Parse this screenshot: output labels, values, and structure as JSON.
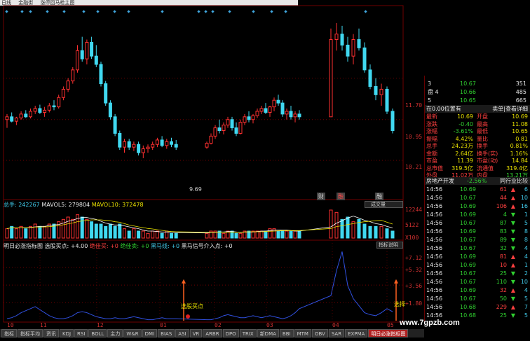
{
  "titlebar": {
    "items": [
      "日线",
      "金融街",
      "涨停回马枪主图"
    ]
  },
  "main_axis": {
    "labels": [
      "11.70",
      "10.95",
      "10.21"
    ]
  },
  "low_marker": "9.69",
  "markers": {
    "m1": "财",
    "m2": "融",
    "m3": "融"
  },
  "vol_legend": {
    "total": "总手: 242267",
    "ma5": "MAVOL5: 279804",
    "ma10": "MAVOL10: 372478"
  },
  "vol_axis": [
    "12244",
    "5122",
    "X100"
  ],
  "vol_badge": "成交量",
  "ind_legend": {
    "title": "明日必涨指标图",
    "a": "选股买点: +4.00",
    "b": "绝佳买: +0",
    "c": "绝佳卖: +0",
    "d": "黑马线: +0",
    "e": "黑马信号介入点: +0"
  },
  "ind_badge": "指标说明",
  "ind_axis": [
    "+7.12",
    "+5.32",
    "+3.56",
    "+1.80"
  ],
  "ind_annotations": {
    "buy": "选股买点",
    "pick": "选择"
  },
  "xaxis": [
    "10",
    "11",
    "12",
    "01",
    "02",
    "03",
    "04",
    "05"
  ],
  "tabs": [
    "指标",
    "指标平均",
    "资讯",
    "KDJ",
    "RSI",
    "BOLL",
    "主力",
    "W&R",
    "DMI",
    "BIAS",
    "ASI",
    "VR",
    "ARBR",
    "DPO",
    "TRIX",
    "新DMA",
    "BBI",
    "MTM",
    "OBV",
    "SAR",
    "EXPMA",
    "明日必涨指标图"
  ],
  "active_tab": "明日必涨指标图",
  "watermark": "www.7gpzb.com",
  "book": [
    {
      "lvl": "3",
      "price": "10.67",
      "vol": "351"
    },
    {
      "lvl": "盘 4",
      "price": "10.66",
      "vol": "485"
    },
    {
      "lvl": "5",
      "price": "10.65",
      "vol": "665"
    }
  ],
  "book_hdr": {
    "left": "在0.00位置有",
    "right": "卖单|查看详细"
  },
  "stats": [
    {
      "k": "最新",
      "v": "10.69",
      "k2": "开盘",
      "v2": "10.69"
    },
    {
      "k": "涨跌",
      "v": "-0.40",
      "k2": "最高",
      "v2": "11.08"
    },
    {
      "k": "涨幅",
      "v": "-3.61%",
      "k2": "最低",
      "v2": "10.65"
    },
    {
      "k": "振幅",
      "v": "4.42%",
      "k2": "量比",
      "v2": "0.81"
    },
    {
      "k": "总手",
      "v": "24.23万",
      "k2": "换手",
      "v2": "0.81%"
    },
    {
      "k": "金额",
      "v": "2.64亿",
      "k2": "换手(实)",
      "v2": "1.16%"
    },
    {
      "k": "市盈",
      "v": "11.39",
      "k2": "市盈(动)",
      "v2": "14.84"
    },
    {
      "k": "总市值",
      "v": "319.5亿",
      "k2": "流通值",
      "v2": "319.4亿"
    },
    {
      "k": "外盘",
      "v": "11.02万",
      "k2": "内盘",
      "v2": "13.21万"
    }
  ],
  "sector": {
    "name": "房地产开发",
    "chg": "-2.56%",
    "link": "同行业比较"
  },
  "ticks": [
    {
      "t": "14:56",
      "p": "10.69",
      "v": "61",
      "d": "up",
      "n": "6"
    },
    {
      "t": "14:56",
      "p": "10.67",
      "v": "44",
      "d": "up",
      "n": "10"
    },
    {
      "t": "14:56",
      "p": "10.69",
      "v": "106",
      "d": "up",
      "n": "16"
    },
    {
      "t": "14:56",
      "p": "10.69",
      "v": "4",
      "d": "dn",
      "n": "1"
    },
    {
      "t": "14:56",
      "p": "10.67",
      "v": "87",
      "d": "dn",
      "n": "5"
    },
    {
      "t": "14:56",
      "p": "10.69",
      "v": "83",
      "d": "dn",
      "n": "8"
    },
    {
      "t": "14:56",
      "p": "10.67",
      "v": "89",
      "d": "dn",
      "n": "8"
    },
    {
      "t": "14:56",
      "p": "10.67",
      "v": "32",
      "d": "dn",
      "n": "4"
    },
    {
      "t": "14:56",
      "p": "10.69",
      "v": "81",
      "d": "up",
      "n": "4"
    },
    {
      "t": "14:56",
      "p": "10.69",
      "v": "10",
      "d": "up",
      "n": "1"
    },
    {
      "t": "14:56",
      "p": "10.67",
      "v": "25",
      "d": "dn",
      "n": "2"
    },
    {
      "t": "14:56",
      "p": "10.67",
      "v": "110",
      "d": "dn",
      "n": "10"
    },
    {
      "t": "14:56",
      "p": "10.69",
      "v": "32",
      "d": "up",
      "n": "4"
    },
    {
      "t": "14:56",
      "p": "10.67",
      "v": "50",
      "d": "dn",
      "n": "5"
    },
    {
      "t": "14:56",
      "p": "10.68",
      "v": "229",
      "d": "up",
      "n": "7"
    },
    {
      "t": "14:56",
      "p": "10.68",
      "v": "25",
      "d": "dn",
      "n": "5"
    }
  ],
  "colors": {
    "up": "#ff3030",
    "down": "#40d8f0",
    "grid": "#700000",
    "ma5": "#ffffff",
    "ma10": "#e8e000",
    "indline": "#3050e0"
  },
  "chart_data": {
    "type": "candlestick",
    "series": [
      {
        "name": "MAVOL5",
        "values": []
      },
      {
        "name": "MAVOL10",
        "values": []
      }
    ],
    "x": [
      "10",
      "11",
      "12",
      "01",
      "02",
      "03",
      "04",
      "05"
    ],
    "ohlc": [
      [
        10.95,
        11.05,
        10.8,
        11.0
      ],
      [
        11.0,
        11.08,
        10.9,
        10.92
      ],
      [
        10.92,
        11.0,
        10.85,
        10.98
      ],
      [
        10.98,
        11.1,
        10.95,
        11.05
      ],
      [
        11.05,
        11.12,
        10.98,
        11.0
      ],
      [
        11.0,
        11.15,
        10.97,
        11.1
      ],
      [
        11.1,
        11.2,
        11.05,
        11.15
      ],
      [
        11.15,
        11.22,
        11.05,
        11.08
      ],
      [
        11.08,
        11.18,
        11.0,
        11.12
      ],
      [
        11.12,
        11.25,
        11.08,
        11.2
      ],
      [
        11.2,
        11.3,
        11.12,
        11.18
      ],
      [
        11.18,
        11.4,
        11.15,
        11.35
      ],
      [
        11.35,
        11.55,
        11.3,
        11.5
      ],
      [
        11.5,
        11.7,
        11.45,
        11.65
      ],
      [
        11.65,
        11.9,
        11.6,
        11.85
      ],
      [
        11.85,
        12.3,
        11.8,
        12.2
      ],
      [
        12.2,
        12.45,
        12.0,
        12.05
      ],
      [
        12.05,
        12.4,
        11.95,
        12.35
      ],
      [
        12.35,
        12.45,
        12.05,
        12.1
      ],
      [
        12.1,
        12.3,
        11.9,
        11.95
      ],
      [
        11.95,
        12.0,
        11.55,
        11.6
      ],
      [
        11.6,
        11.65,
        11.2,
        11.25
      ],
      [
        11.25,
        11.3,
        10.95,
        11.0
      ],
      [
        11.0,
        11.05,
        10.65,
        10.7
      ],
      [
        10.7,
        10.75,
        10.4,
        10.45
      ],
      [
        10.45,
        10.6,
        10.35,
        10.55
      ],
      [
        10.55,
        10.6,
        10.4,
        10.45
      ],
      [
        10.45,
        10.55,
        10.38,
        10.5
      ],
      [
        10.5,
        10.55,
        10.3,
        10.35
      ],
      [
        10.35,
        10.48,
        10.25,
        10.42
      ],
      [
        10.42,
        10.5,
        10.35,
        10.45
      ],
      [
        10.45,
        10.55,
        10.4,
        10.5
      ],
      [
        10.5,
        10.62,
        10.45,
        10.58
      ],
      [
        10.58,
        10.65,
        10.45,
        10.48
      ],
      [
        10.48,
        10.6,
        10.42,
        10.55
      ],
      [
        10.55,
        10.62,
        10.45,
        10.5
      ],
      [
        10.5,
        10.58,
        10.4,
        10.45
      ],
      [
        10.45,
        10.55,
        10.42,
        10.52
      ],
      [
        10.52,
        10.7,
        10.5,
        10.65
      ],
      [
        10.65,
        10.85,
        10.6,
        10.8
      ],
      [
        10.8,
        10.95,
        10.7,
        10.75
      ],
      [
        10.75,
        10.9,
        10.68,
        10.85
      ],
      [
        10.85,
        11.0,
        10.8,
        10.95
      ],
      [
        10.95,
        11.0,
        10.75,
        10.8
      ],
      [
        10.8,
        10.9,
        10.65,
        10.7
      ],
      [
        10.7,
        10.95,
        10.68,
        10.9
      ],
      [
        10.9,
        11.05,
        10.85,
        11.0
      ],
      [
        11.0,
        11.1,
        10.9,
        10.95
      ],
      [
        10.95,
        11.05,
        10.88,
        11.02
      ],
      [
        11.02,
        11.15,
        10.98,
        11.1
      ],
      [
        11.1,
        11.2,
        11.05,
        11.15
      ],
      [
        11.15,
        11.25,
        11.05,
        11.08
      ],
      [
        11.08,
        11.2,
        11.0,
        11.18
      ],
      [
        11.18,
        11.35,
        11.1,
        11.3
      ],
      [
        11.3,
        11.4,
        11.2,
        11.25
      ],
      [
        11.25,
        11.3,
        11.0,
        11.05
      ],
      [
        11.05,
        11.15,
        10.95,
        11.1
      ],
      [
        11.1,
        11.2,
        10.95,
        11.0
      ],
      [
        11.0,
        11.1,
        10.9,
        11.05
      ],
      [
        11.05,
        11.12,
        10.95,
        11.0
      ],
      [
        11.0,
        12.6,
        11.0,
        12.4
      ],
      [
        12.4,
        12.7,
        12.2,
        12.5
      ],
      [
        12.5,
        12.65,
        12.2,
        12.3
      ],
      [
        12.3,
        12.45,
        12.0,
        12.1
      ],
      [
        12.1,
        12.5,
        11.95,
        12.4
      ],
      [
        12.4,
        12.6,
        12.2,
        12.25
      ],
      [
        12.25,
        12.35,
        11.8,
        11.85
      ],
      [
        11.85,
        11.95,
        11.5,
        11.55
      ],
      [
        11.55,
        11.7,
        11.3,
        11.4
      ],
      [
        11.4,
        11.6,
        11.2,
        11.5
      ],
      [
        11.5,
        11.55,
        11.05,
        11.1
      ],
      [
        11.1,
        11.15,
        10.7,
        10.75
      ]
    ],
    "volume": [
      4,
      5,
      4,
      5,
      4,
      5,
      6,
      5,
      5,
      6,
      6,
      7,
      8,
      9,
      8,
      10,
      9,
      8,
      7,
      6,
      6,
      5,
      6,
      5,
      6,
      4,
      3,
      4,
      3,
      3,
      2,
      3,
      3,
      2,
      3,
      2,
      2,
      2,
      3,
      3,
      3,
      2,
      3,
      3,
      2,
      2,
      3,
      3,
      3,
      3,
      3,
      3,
      4,
      4,
      3,
      3,
      3,
      3,
      3,
      3,
      12,
      11,
      8,
      9,
      7,
      8,
      6,
      5,
      5,
      5,
      4,
      3
    ],
    "indicator": [
      0.2,
      0.3,
      0.5,
      0.8,
      1.0,
      1.2,
      1.4,
      1.1,
      0.8,
      0.5,
      0.3,
      0.2,
      0.2,
      0.3,
      0.5,
      0.8,
      0.9,
      0.8,
      0.6,
      0.4,
      0.3,
      0.2,
      0.2,
      0.3,
      0.2,
      0.2,
      0.3,
      0.4,
      0.3,
      0.2,
      0.1,
      0.1,
      0.2,
      0.3,
      0.2,
      0.2,
      0.2,
      0.1,
      0.1,
      0.2,
      0.3,
      0.5,
      0.6,
      0.5,
      0.4,
      0.3,
      0.3,
      0.4,
      0.5,
      0.4,
      0.3,
      0.4,
      0.5,
      0.4,
      0.3,
      0.2,
      0.3,
      0.5,
      0.8,
      1.2,
      2.5,
      5.0,
      6.9,
      3.5,
      2.2,
      1.5,
      0.8,
      0.6,
      0.5,
      0.8,
      1.2,
      0.9
    ],
    "ylim": [
      9.5,
      12.8
    ]
  }
}
